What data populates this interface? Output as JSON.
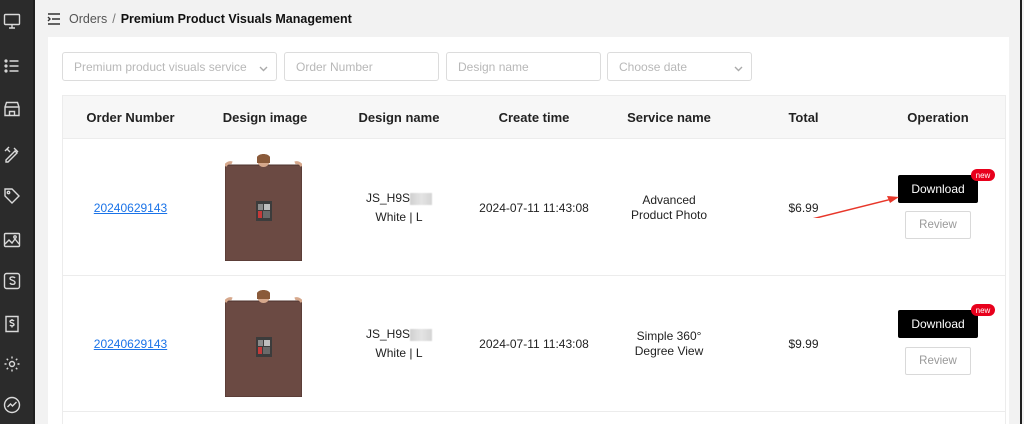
{
  "breadcrumb": {
    "parent": "Orders",
    "separator": "/",
    "current": "Premium Product Visuals Management"
  },
  "filters": {
    "service": {
      "placeholder": "Premium product visuals service"
    },
    "order_number": {
      "placeholder": "Order Number"
    },
    "design_name": {
      "placeholder": "Design name"
    },
    "date": {
      "placeholder": "Choose date"
    }
  },
  "table": {
    "headers": [
      "Order Number",
      "Design image",
      "Design name",
      "Create time",
      "Service name",
      "Total",
      "Operation"
    ],
    "rows": [
      {
        "order_number": "20240629143",
        "design_name_line1": "JS_H9S",
        "design_name_line2": "White | L",
        "create_time": "2024-07-11 11:43:08",
        "service_name": "Advanced Product Photo",
        "total": "$6.99",
        "download_label": "Download",
        "badge": "new",
        "review_label": "Review"
      },
      {
        "order_number": "20240629143",
        "design_name_line1": "JS_H9S",
        "design_name_line2": "White | L",
        "create_time": "2024-07-11 11:43:08",
        "service_name": "Simple 360° Degree View",
        "total": "$9.99",
        "download_label": "Download",
        "badge": "new",
        "review_label": "Review"
      }
    ]
  },
  "sidebar": {
    "icons": [
      "monitor-icon",
      "list-icon",
      "store-icon",
      "design-tools-icon",
      "tag-icon",
      "image-icon",
      "s-box-icon",
      "dollar-receipt-icon",
      "gear-icon",
      "trend-icon"
    ]
  },
  "colors": {
    "accent_link": "#1a73e8",
    "badge_red": "#e8001c",
    "annotation_arrow": "#e8372a"
  }
}
